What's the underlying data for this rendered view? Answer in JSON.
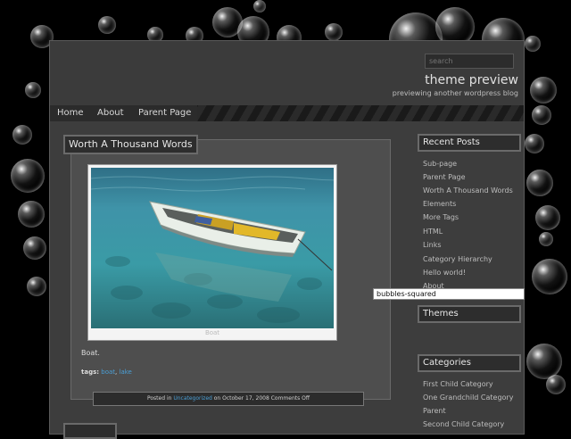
{
  "header": {
    "search_placeholder": "search",
    "site_title": "theme preview",
    "site_description": "previewing another wordpress blog"
  },
  "nav": {
    "items": [
      "Home",
      "About",
      "Parent Page"
    ]
  },
  "post": {
    "title": "Worth A Thousand Words",
    "image_caption": "Boat",
    "text": "Boat.",
    "tags_label": "tags:",
    "tags": [
      "boat",
      "lake"
    ],
    "meta_prefix": "Posted in",
    "meta_category": "Uncategorized",
    "meta_date": "on October 17, 2008",
    "meta_comments": "Comments Off"
  },
  "sidebar": {
    "recent_posts_title": "Recent Posts",
    "recent_posts": [
      "Sub-page",
      "Parent Page",
      "Worth A Thousand Words",
      "Elements",
      "More Tags",
      "HTML",
      "Links",
      "Category Hierarchy",
      "Hello world!",
      "About"
    ],
    "themes_title": "Themes",
    "themes_selected": "bubbles-squared",
    "categories_title": "Categories",
    "categories": [
      "First Child Category",
      "One Grandchild Category",
      "Parent",
      "Second Child Category"
    ]
  },
  "colors": {
    "link": "#4a9fd6",
    "background": "#000000",
    "panel": "#3d3d3d"
  }
}
